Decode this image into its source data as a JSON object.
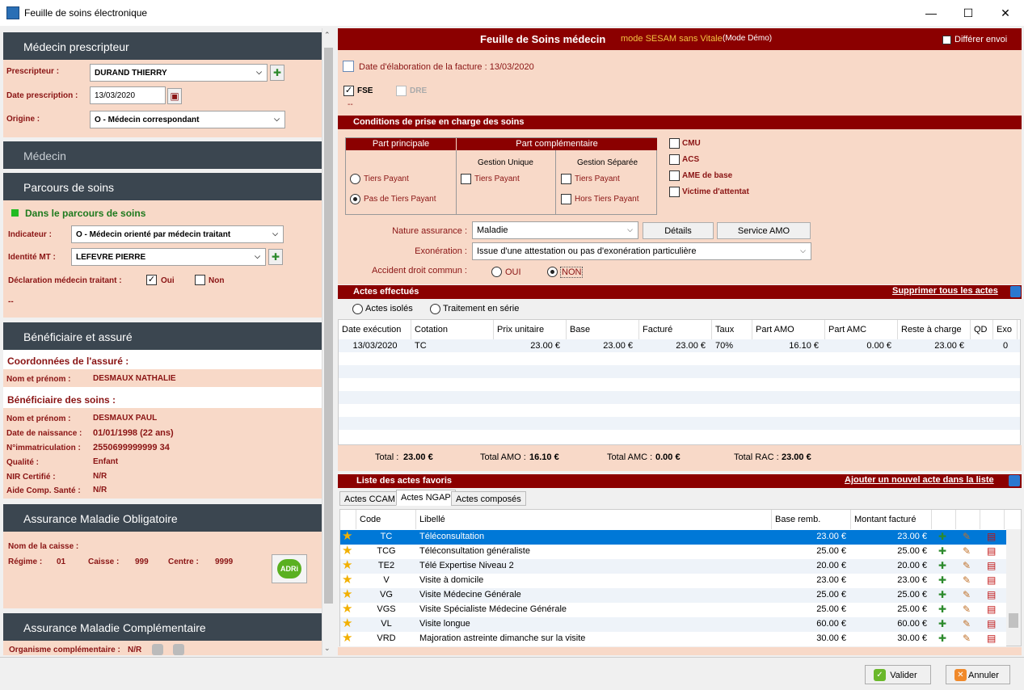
{
  "window": {
    "title": "Feuille de soins électronique",
    "minimize": "—",
    "maximize": "☐",
    "close": "✕"
  },
  "prescripteur": {
    "header": "Médecin prescripteur",
    "prescripteur_label": "Prescripteur :",
    "prescripteur_value": "DURAND THIERRY",
    "date_label": "Date prescription :",
    "date_value": "13/03/2020",
    "origine_label": "Origine :",
    "origine_value": "O - Médecin correspondant"
  },
  "medecin": {
    "header": "Médecin"
  },
  "parcours": {
    "header": "Parcours de soins",
    "status": "Dans le parcours de soins",
    "status_color": "#22bb22",
    "indicateur_label": "Indicateur :",
    "indicateur_value": "O - Médecin orienté par médecin traitant",
    "identite_label": "Identité MT :",
    "identite_value": "LEFEVRE PIERRE",
    "declaration_label": "Déclaration médecin traitant :",
    "oui": "Oui",
    "non": "Non",
    "dash": "--"
  },
  "beneficiaire": {
    "header": "Bénéficiaire et assuré",
    "coord_title": "Coordonnées de l'assuré :",
    "assure_nom_label": "Nom et prénom :",
    "assure_nom": "DESMAUX NATHALIE",
    "benef_title": "Bénéficiaire des soins :",
    "nom_label": "Nom et prénom :",
    "nom": "DESMAUX PAUL",
    "naissance_label": "Date de naissance :",
    "naissance": "01/01/1998 (22 ans)",
    "immat_label": "N°immatriculation :",
    "immat": "2550699999999 34",
    "qualite_label": "Qualité :",
    "qualite": "Enfant",
    "nir_label": "NIR Certifié :",
    "nir": "N/R",
    "aide_label": "Aide Comp. Santé :",
    "aide": "N/R"
  },
  "amo": {
    "header": "Assurance Maladie Obligatoire",
    "caisse_label": "Nom de la caisse :",
    "regime_label": "Régime :",
    "regime": "01",
    "caisse_lbl": "Caisse :",
    "caisse": "999",
    "centre_label": "Centre :",
    "centre": "9999",
    "adri": "ADRi"
  },
  "amc": {
    "header": "Assurance Maladie Complémentaire",
    "organisme_label": "Organisme complémentaire :",
    "organisme": "N/R"
  },
  "fse": {
    "title": "Feuille de Soins médecin",
    "mode": "mode SESAM sans Vitale",
    "demo": "(Mode Démo)",
    "differer": "Différer envoi",
    "date_elab": "Date d'élaboration de la facture : 13/03/2020",
    "fse_label": "FSE",
    "dre_label": "DRE",
    "dash": "--"
  },
  "conditions": {
    "header": "Conditions de prise en charge des soins",
    "part_principale": "Part principale",
    "part_complementaire": "Part complémentaire",
    "gestion_unique": "Gestion Unique",
    "gestion_separee": "Gestion Séparée",
    "tiers_payant": "Tiers Payant",
    "pas_tiers_payant": "Pas de Tiers Payant",
    "hors_tiers_payant": "Hors Tiers Payant",
    "cmu": "CMU",
    "acs": "ACS",
    "ame": "AME de base",
    "victime": "Victime d'attentat",
    "nature_label": "Nature assurance :",
    "nature_value": "Maladie",
    "details": "Détails",
    "service_amo": "Service AMO",
    "exoneration_label": "Exonération :",
    "exoneration_value": "Issue d'une attestation ou pas d'exonération particulière",
    "accident_label": "Accident droit commun :",
    "oui": "OUI",
    "non": "NON"
  },
  "actes": {
    "header": "Actes effectués",
    "supprimer": "Supprimer tous les actes",
    "isoles": "Actes isolés",
    "serie": "Traitement en série",
    "columns": [
      "Date exécution",
      "Cotation",
      "Prix unitaire",
      "Base",
      "Facturé",
      "Taux",
      "Part AMO",
      "Part AMC",
      "Reste à charge",
      "QD",
      "Exo"
    ],
    "rows": [
      [
        "13/03/2020",
        "TC",
        "23.00 €",
        "23.00 €",
        "23.00 €",
        "70%",
        "16.10 €",
        "0.00 €",
        "23.00 €",
        "",
        "0"
      ]
    ],
    "total_label": "Total :",
    "total": "23.00 €",
    "total_amo_label": "Total AMO :",
    "total_amo": "16.10 €",
    "total_amc_label": "Total AMC :",
    "total_amc": "0.00 €",
    "total_rac_label": "Total RAC :",
    "total_rac": "23.00 €"
  },
  "favoris": {
    "header": "Liste des actes favoris",
    "ajouter": "Ajouter un nouvel acte dans la liste",
    "tabs": [
      "Actes CCAM",
      "Actes NGAP",
      "Actes composés"
    ],
    "columns": [
      "Code",
      "Libellé",
      "Base remb.",
      "Montant facturé"
    ],
    "rows": [
      [
        "TC",
        "Téléconsultation",
        "23.00 €",
        "23.00 €"
      ],
      [
        "TCG",
        "Téléconsultation généraliste",
        "25.00 €",
        "25.00 €"
      ],
      [
        "TE2",
        "Télé Expertise Niveau 2",
        "20.00 €",
        "20.00 €"
      ],
      [
        "V",
        "Visite à domicile",
        "23.00 €",
        "23.00 €"
      ],
      [
        "VG",
        "Visite Médecine Générale",
        "25.00 €",
        "25.00 €"
      ],
      [
        "VGS",
        "Visite Spécialiste Médecine Générale",
        "25.00 €",
        "25.00 €"
      ],
      [
        "VL",
        "Visite longue",
        "60.00 €",
        "60.00 €"
      ],
      [
        "VRD",
        "Majoration astreinte dimanche sur la visite",
        "30.00 €",
        "30.00 €"
      ]
    ]
  },
  "footer": {
    "valider": "Valider",
    "annuler": "Annuler"
  }
}
